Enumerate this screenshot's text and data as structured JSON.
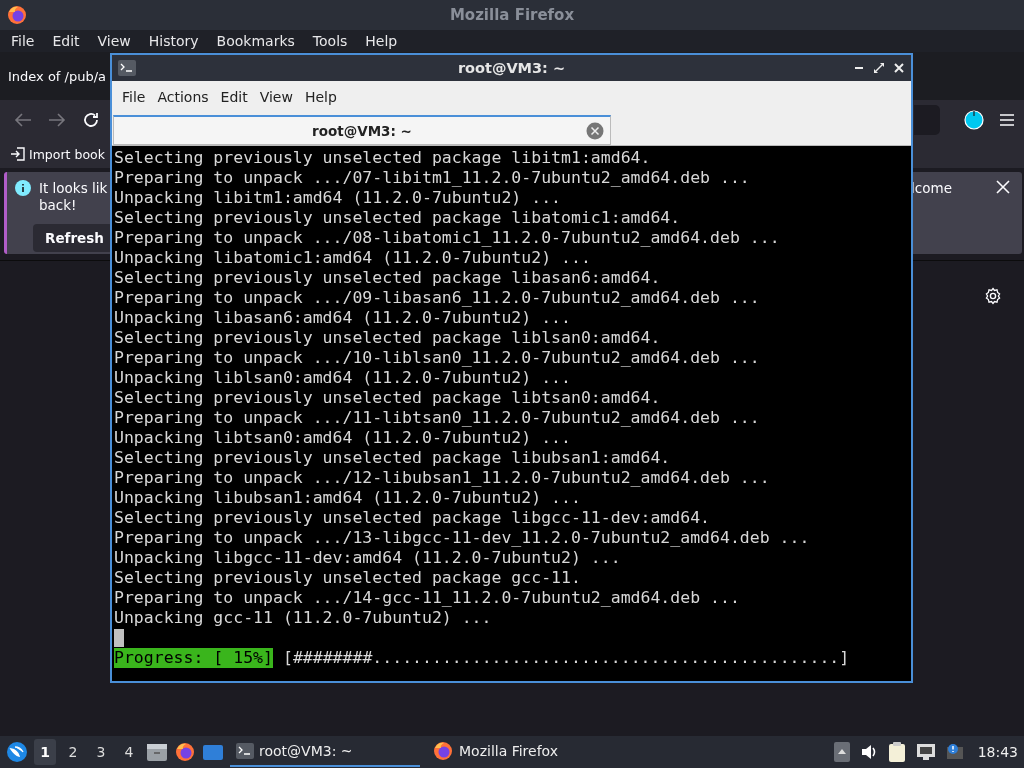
{
  "firefox": {
    "title": "Mozilla Firefox",
    "menu": [
      "File",
      "Edit",
      "View",
      "History",
      "Bookmarks",
      "Tools",
      "Help"
    ],
    "tab_title": "Index of /pub/a",
    "bookmark": "Import book",
    "notification": {
      "text_start": "It looks lik",
      "text_line2": "back!",
      "text_end": "lcome",
      "button": "Refresh"
    }
  },
  "terminal": {
    "title": "root@VM3: ~",
    "menu": [
      "File",
      "Actions",
      "Edit",
      "View",
      "Help"
    ],
    "tabs": [
      {
        "label": "root@VM3: ~",
        "selected": true
      }
    ],
    "lines": [
      "Selecting previously unselected package libitm1:amd64.",
      "Preparing to unpack .../07-libitm1_11.2.0-7ubuntu2_amd64.deb ...",
      "Unpacking libitm1:amd64 (11.2.0-7ubuntu2) ...",
      "Selecting previously unselected package libatomic1:amd64.",
      "Preparing to unpack .../08-libatomic1_11.2.0-7ubuntu2_amd64.deb ...",
      "Unpacking libatomic1:amd64 (11.2.0-7ubuntu2) ...",
      "Selecting previously unselected package libasan6:amd64.",
      "Preparing to unpack .../09-libasan6_11.2.0-7ubuntu2_amd64.deb ...",
      "Unpacking libasan6:amd64 (11.2.0-7ubuntu2) ...",
      "Selecting previously unselected package liblsan0:amd64.",
      "Preparing to unpack .../10-liblsan0_11.2.0-7ubuntu2_amd64.deb ...",
      "Unpacking liblsan0:amd64 (11.2.0-7ubuntu2) ...",
      "Selecting previously unselected package libtsan0:amd64.",
      "Preparing to unpack .../11-libtsan0_11.2.0-7ubuntu2_amd64.deb ...",
      "Unpacking libtsan0:amd64 (11.2.0-7ubuntu2) ...",
      "Selecting previously unselected package libubsan1:amd64.",
      "Preparing to unpack .../12-libubsan1_11.2.0-7ubuntu2_amd64.deb ...",
      "Unpacking libubsan1:amd64 (11.2.0-7ubuntu2) ...",
      "Selecting previously unselected package libgcc-11-dev:amd64.",
      "Preparing to unpack .../13-libgcc-11-dev_11.2.0-7ubuntu2_amd64.deb ...",
      "Unpacking libgcc-11-dev:amd64 (11.2.0-7ubuntu2) ...",
      "Selecting previously unselected package gcc-11.",
      "Preparing to unpack .../14-gcc-11_11.2.0-7ubuntu2_amd64.deb ...",
      "Unpacking gcc-11 (11.2.0-7ubuntu2) ..."
    ],
    "progress": {
      "label": "Progress: [ 15%]",
      "bar": "[########...............................................]"
    }
  },
  "taskbar": {
    "workspaces": [
      {
        "label": "1",
        "selected": true
      },
      {
        "label": "2",
        "selected": false
      },
      {
        "label": "3",
        "selected": false
      },
      {
        "label": "4",
        "selected": false
      }
    ],
    "tasks": [
      {
        "label": "root@VM3: ~",
        "kind": "terminal",
        "selected": true
      },
      {
        "label": "Mozilla Firefox",
        "kind": "firefox",
        "selected": false
      }
    ],
    "clock": "18:43"
  }
}
